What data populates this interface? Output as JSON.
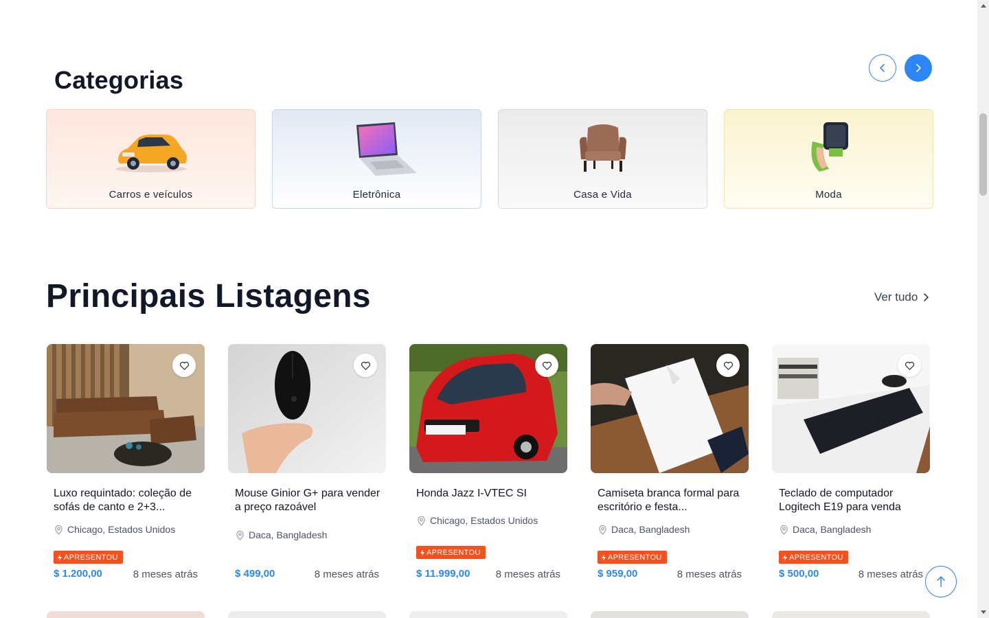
{
  "categories": {
    "title": "Categorias",
    "items": [
      {
        "label": "Carros e veículos",
        "icon": "car-image"
      },
      {
        "label": "Eletrônica",
        "icon": "laptop-image"
      },
      {
        "label": "Casa e Vida",
        "icon": "armchair-image"
      },
      {
        "label": "Moda",
        "icon": "smartwatch-image"
      }
    ]
  },
  "listings": {
    "title": "Principais Listagens",
    "see_all": "Ver tudo",
    "badge_label": "APRESENTOU",
    "items": [
      {
        "title": "Luxo requintado: coleção de sofás de canto e 2+3...",
        "location": "Chicago, Estados Unidos",
        "featured": true,
        "price": "$ 1.200,00",
        "time": "8 meses atrás"
      },
      {
        "title": "Mouse Ginior G+ para vender a preço razoável",
        "location": "Daca, Bangladesh",
        "featured": false,
        "price": "$ 499,00",
        "time": "8 meses atrás"
      },
      {
        "title": "Honda Jazz I-VTEC SI",
        "location": "Chicago, Estados Unidos",
        "featured": true,
        "price": "$ 11.999,00",
        "time": "8 meses atrás"
      },
      {
        "title": "Camiseta branca formal para escritório e festa...",
        "location": "Daca, Bangladesh",
        "featured": true,
        "price": "$ 959,00",
        "time": "8 meses atrás"
      },
      {
        "title": "Teclado de computador Logitech E19 para venda",
        "location": "Daca, Bangladesh",
        "featured": true,
        "price": "$ 500,00",
        "time": "8 meses atrás"
      }
    ]
  },
  "colors": {
    "accent": "#2b87f5",
    "badge": "#f4511e",
    "text": "#111827"
  }
}
